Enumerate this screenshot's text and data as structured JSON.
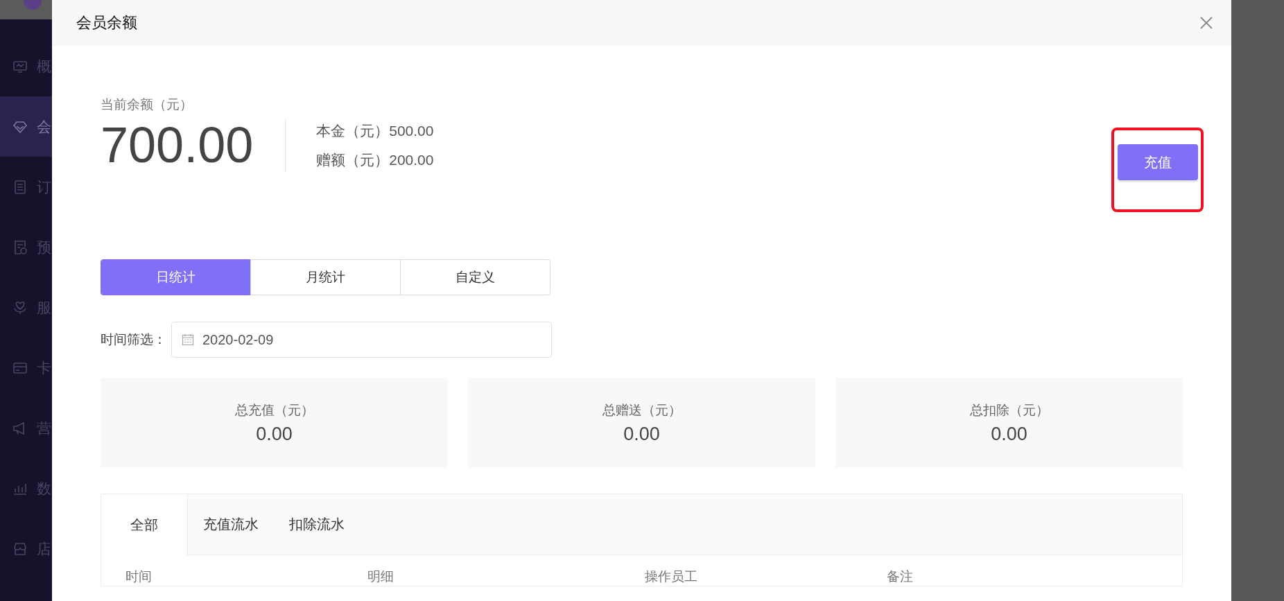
{
  "sidebar": {
    "items": [
      {
        "label": "概",
        "selected": false
      },
      {
        "label": "会",
        "selected": true
      },
      {
        "label": "订",
        "selected": false
      },
      {
        "label": "预",
        "selected": false
      },
      {
        "label": "服",
        "selected": false
      },
      {
        "label": "卡",
        "selected": false
      },
      {
        "label": "营",
        "selected": false
      },
      {
        "label": "数",
        "selected": false
      },
      {
        "label": "店",
        "selected": false
      }
    ]
  },
  "modal": {
    "title": "会员余额",
    "balance": {
      "label": "当前余额（元）",
      "amount": "700.00",
      "principal": "本金（元）500.00",
      "bonus": "赠额（元）200.00"
    },
    "recharge_button": "充值",
    "period_tabs": [
      {
        "label": "日统计",
        "selected": true
      },
      {
        "label": "月统计",
        "selected": false
      },
      {
        "label": "自定义",
        "selected": false
      }
    ],
    "date_filter": {
      "label": "时间筛选：",
      "value": "2020-02-09"
    },
    "stats": [
      {
        "label": "总充值（元）",
        "value": "0.00"
      },
      {
        "label": "总赠送（元）",
        "value": "0.00"
      },
      {
        "label": "总扣除（元）",
        "value": "0.00"
      }
    ],
    "record_tabs": [
      {
        "label": "全部",
        "selected": true
      },
      {
        "label": "充值流水",
        "selected": false
      },
      {
        "label": "扣除流水",
        "selected": false
      }
    ],
    "table": {
      "columns": [
        "时间",
        "明细",
        "操作员工",
        "备注"
      ]
    }
  }
}
